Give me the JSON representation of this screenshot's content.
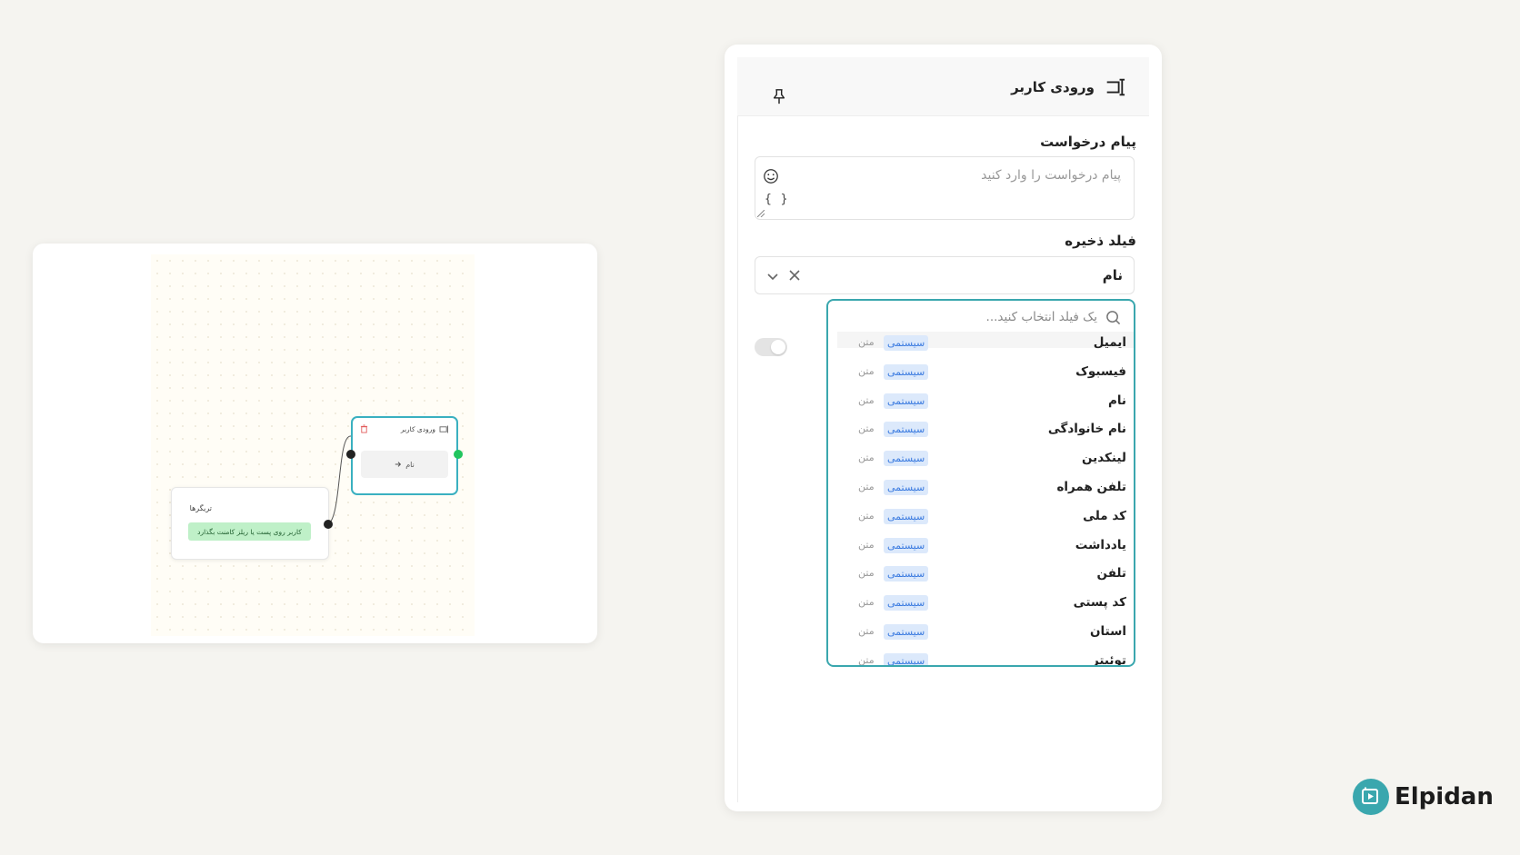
{
  "canvas": {
    "trigger_node": {
      "title": "تریگرها",
      "pill": "کاربر روی پست یا ریلز کامنت بگذارد"
    },
    "input_node": {
      "title": "ورودی کاربر",
      "field": "نام"
    }
  },
  "panel": {
    "title": "ورودی کاربر",
    "request_label": "پیام درخواست",
    "request_placeholder": "پیام درخواست را وارد کنید",
    "variables_glyph": "{ }",
    "save_field_label": "فیلد ذخیره",
    "save_field_value": "نام",
    "dropdown": {
      "search_placeholder": "یک فیلد انتخاب کنید...",
      "options": [
        {
          "name": "ایمیل",
          "badge": "سیستمی",
          "type": "متن"
        },
        {
          "name": "فیسبوک",
          "badge": "سیستمی",
          "type": "متن"
        },
        {
          "name": "نام",
          "badge": "سیستمی",
          "type": "متن"
        },
        {
          "name": "نام خانوادگی",
          "badge": "سیستمی",
          "type": "متن"
        },
        {
          "name": "لینکدین",
          "badge": "سیستمی",
          "type": "متن"
        },
        {
          "name": "تلفن همراه",
          "badge": "سیستمی",
          "type": "متن"
        },
        {
          "name": "کد ملی",
          "badge": "سیستمی",
          "type": "متن"
        },
        {
          "name": "یادداشت",
          "badge": "سیستمی",
          "type": "متن"
        },
        {
          "name": "تلفن",
          "badge": "سیستمی",
          "type": "متن"
        },
        {
          "name": "کد پستی",
          "badge": "سیستمی",
          "type": "متن"
        },
        {
          "name": "استان",
          "badge": "سیستمی",
          "type": "متن"
        },
        {
          "name": "توئیتر",
          "badge": "سیستمی",
          "type": "متن"
        }
      ]
    }
  },
  "logo": {
    "text": "Elpidan"
  },
  "colors": {
    "accent": "#3aa7ae",
    "badge_bg": "#dce9fb",
    "badge_text": "#3b7be0",
    "trigger_pill": "#bff0c8",
    "connector_green": "#22c55e"
  },
  "icons": [
    "user-input-icon",
    "pin-icon",
    "smile-icon",
    "braces-icon",
    "close-icon",
    "chevron-down-icon",
    "search-icon",
    "trash-icon",
    "arrow-right-icon",
    "logo-play-icon"
  ]
}
